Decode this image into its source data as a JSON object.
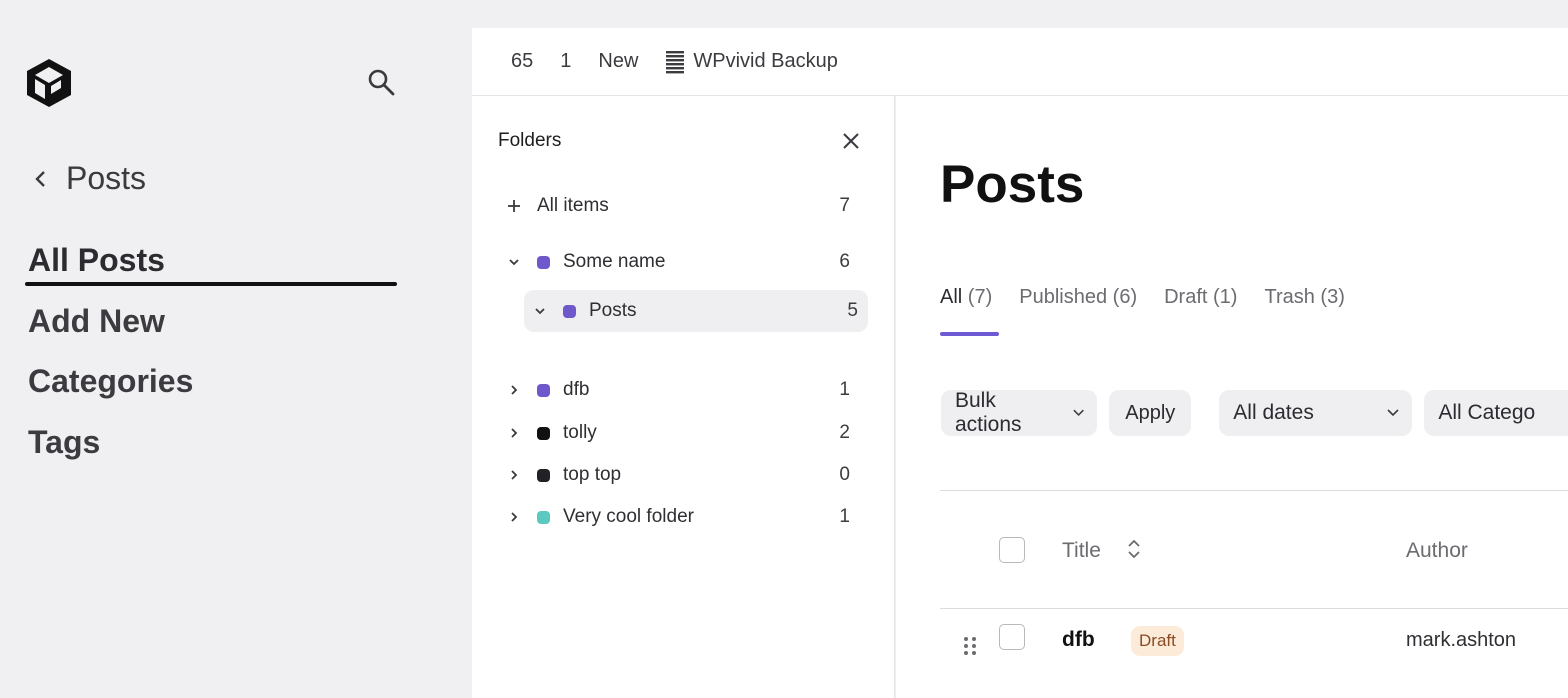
{
  "sidebar": {
    "back_label": "Posts",
    "nav": [
      "All Posts",
      "Add New",
      "Categories",
      "Tags"
    ]
  },
  "topbar": {
    "updates": "65",
    "comments": "1",
    "new_label": "New",
    "backup_label": "WPvivid Backup"
  },
  "folders": {
    "title": "Folders",
    "all_items": {
      "label": "All items",
      "count": "7"
    },
    "items": [
      {
        "label": "Some name",
        "count": "6",
        "color": "#6f58c9"
      },
      {
        "label": "Posts",
        "count": "5",
        "color": "#6f58c9"
      },
      {
        "label": "dfb",
        "count": "1",
        "color": "#6f58c9"
      },
      {
        "label": "tolly",
        "count": "2",
        "color": "#111111"
      },
      {
        "label": "top top",
        "count": "0",
        "color": "#222226"
      },
      {
        "label": "Very cool folder",
        "count": "1",
        "color": "#5cc9c0"
      }
    ]
  },
  "main": {
    "title": "Posts",
    "tabs": [
      {
        "label": "All",
        "count": "(7)"
      },
      {
        "label": "Published",
        "count": "(6)"
      },
      {
        "label": "Draft",
        "count": "(1)"
      },
      {
        "label": "Trash",
        "count": "(3)"
      }
    ],
    "bulk_actions": "Bulk actions",
    "apply": "Apply",
    "dates": "All dates",
    "categories": "All Catego",
    "columns": {
      "title": "Title",
      "author": "Author"
    },
    "rows": [
      {
        "title": "dfb",
        "status": "Draft",
        "author": "mark.ashton"
      }
    ]
  },
  "colors": {
    "accent": "#6e5bd4",
    "draft_badge_bg": "#fcebd9"
  }
}
